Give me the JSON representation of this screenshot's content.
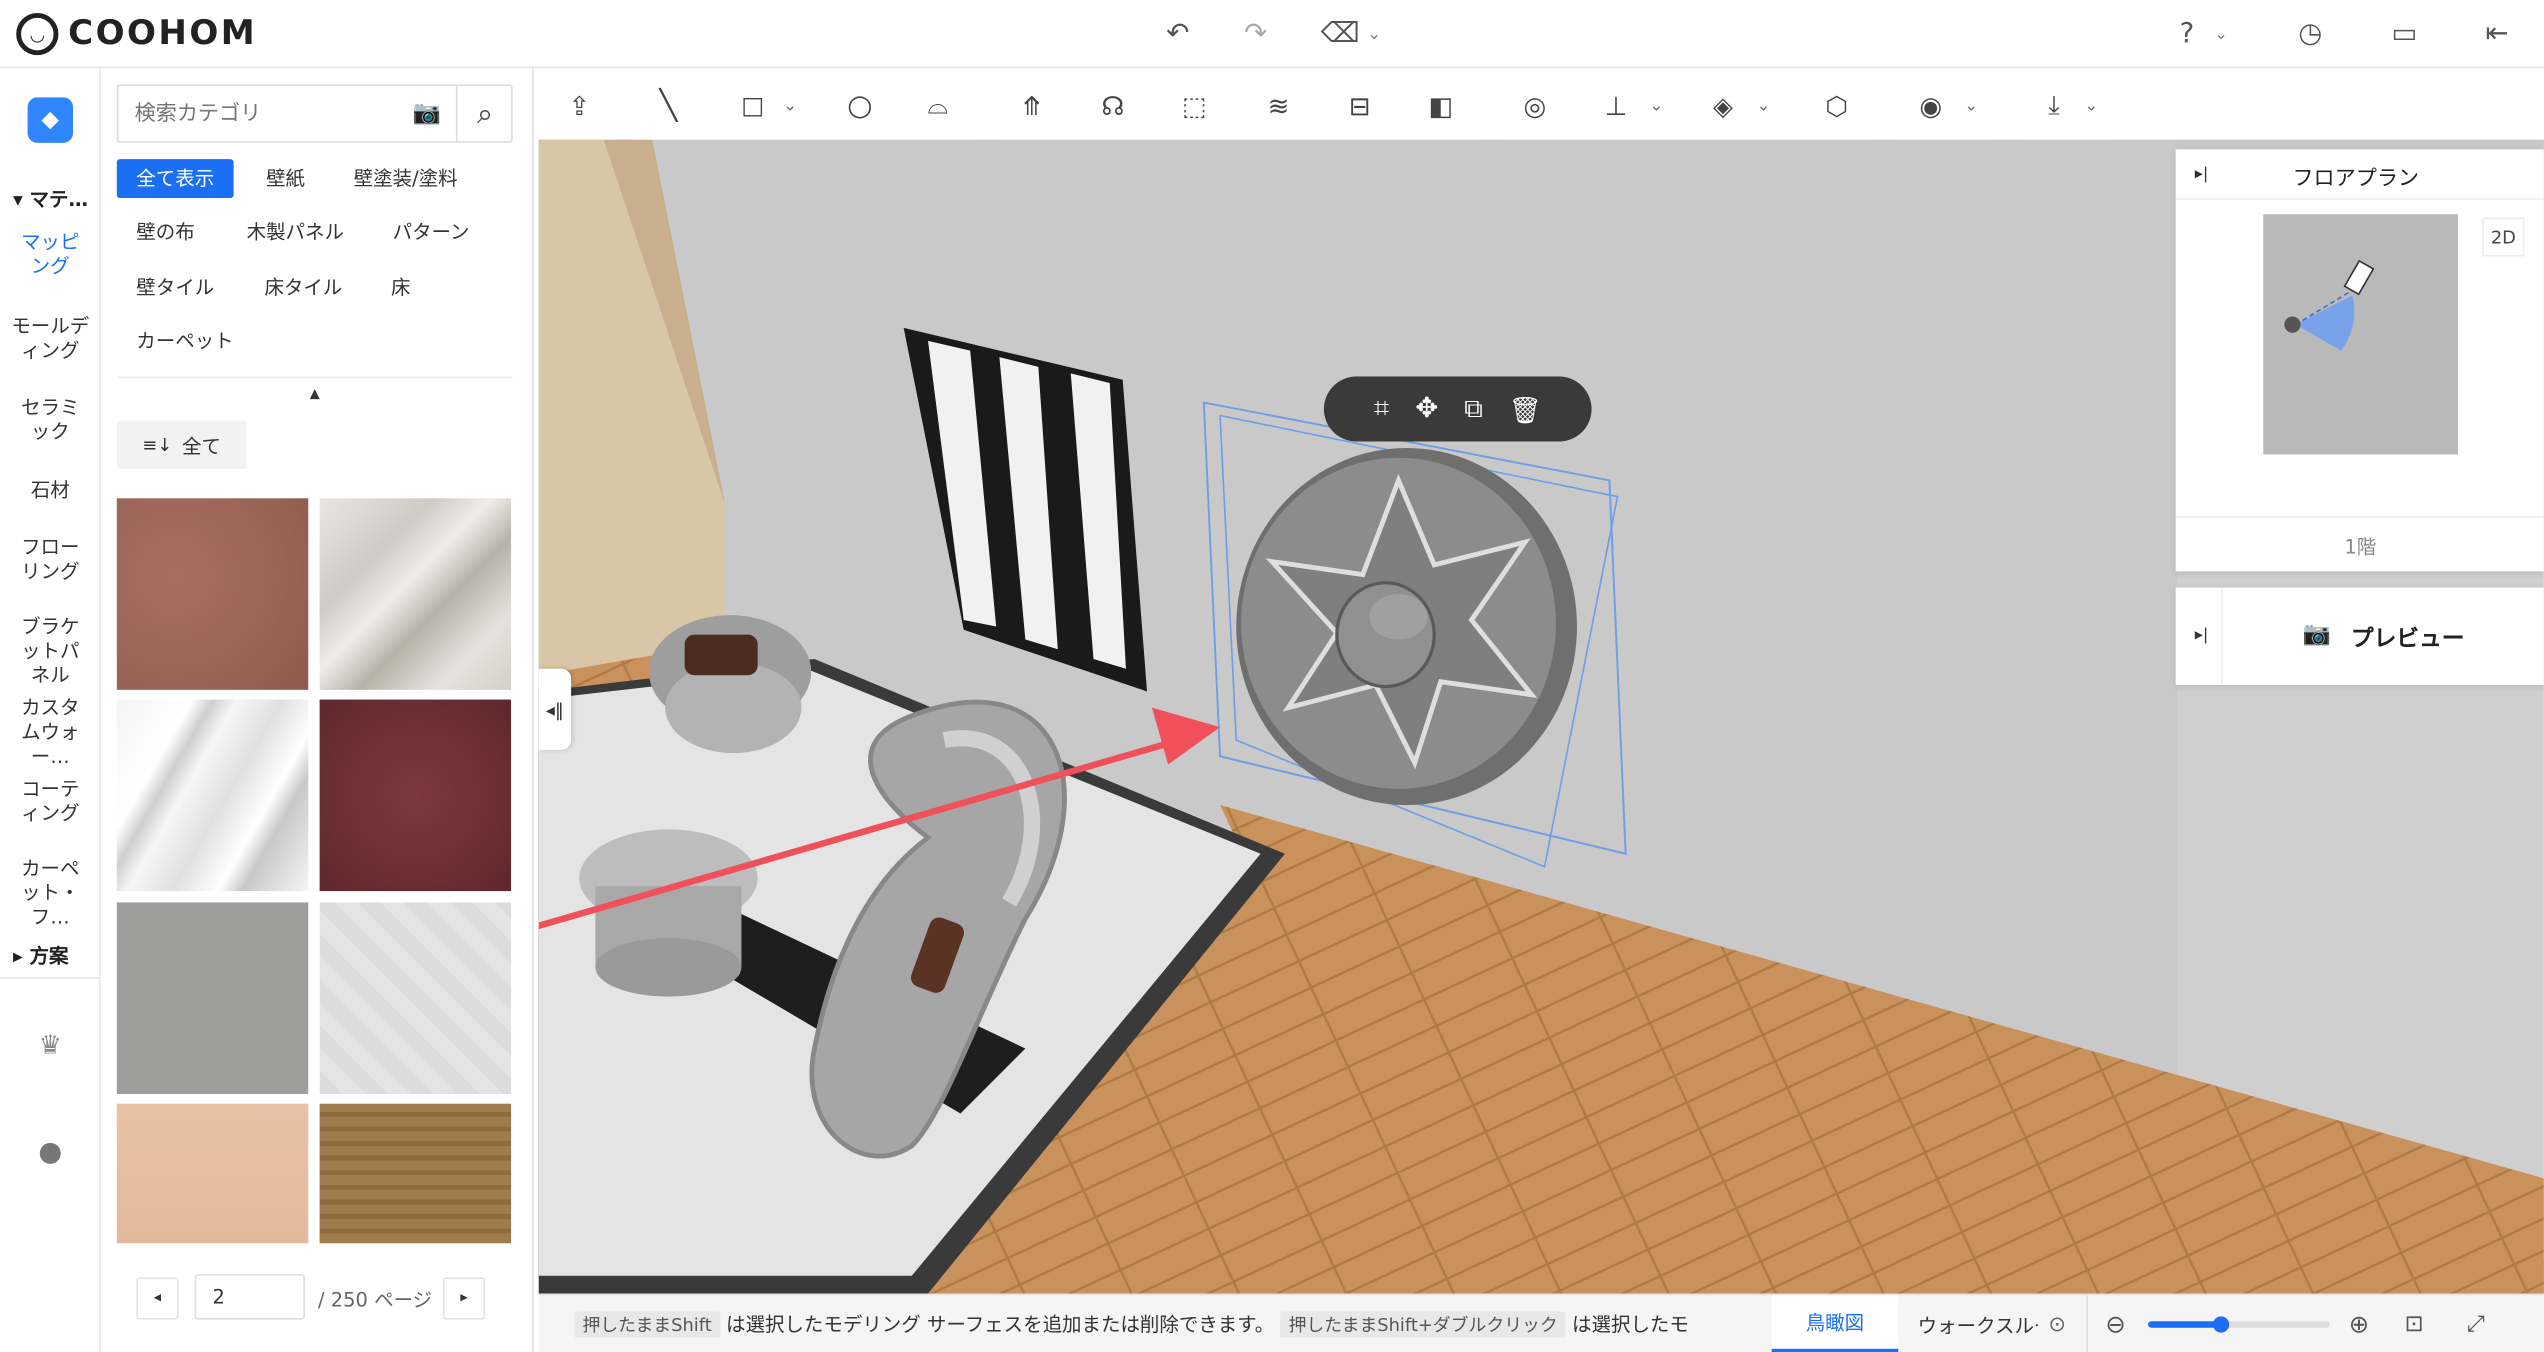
{
  "app": {
    "logo": "COOHOM"
  },
  "topbar": {
    "undo_icon": "undo-icon",
    "redo_icon": "redo-icon",
    "eraser_icon": "eraser-icon",
    "help_icon": "help-icon",
    "history_icon": "clock-icon",
    "save_icon": "save-icon",
    "exit_icon": "exit-icon"
  },
  "rail": {
    "section_materials": "マテ…",
    "items": [
      "マッピング",
      "モールディング",
      "セラミック",
      "石材",
      "フローリング",
      "ブラケットパネル",
      "カスタムウォー…",
      "コーティング",
      "カーペット・フ…"
    ],
    "section_plans": "方案"
  },
  "panel": {
    "search_placeholder": "検索カテゴリ",
    "chips": [
      "全て表示",
      "壁紙",
      "壁塗装/塗料",
      "壁の布",
      "木製パネル",
      "パターン",
      "壁タイル",
      "床タイル",
      "床",
      "カーペット"
    ],
    "filter_label": "全て",
    "pagination": {
      "current": "2",
      "total": "/ 250 ページ"
    }
  },
  "floorplan": {
    "title": "フロアプラン",
    "view_badge": "2D",
    "level": "1階"
  },
  "preview": {
    "title": "プレビュー"
  },
  "status": {
    "hint1_key": "押したままShift",
    "hint1_text": "は選択したモデリング サーフェスを追加または削除できます。",
    "hint2_key": "押したままShift+ダブルクリック",
    "hint2_text": "は選択したモ",
    "view_tabs": [
      "鳥瞰図",
      "ウォークスルー"
    ]
  },
  "colors": {
    "accent": "#1a6ff5",
    "arrow": "#f0505a"
  }
}
